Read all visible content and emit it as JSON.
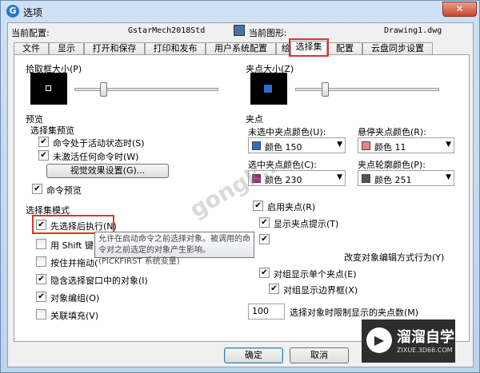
{
  "titlebar": {
    "title": "选项",
    "app_icon": "G",
    "close_glyph": "✕"
  },
  "config": {
    "current_profile_label": "当前配置:",
    "current_profile_value": "GstarMech2018Std",
    "current_drawing_label": "当前图形:",
    "current_drawing_value": "Drawing1.dwg"
  },
  "tabs": [
    "文件",
    "显示",
    "打开和保存",
    "打印和发布",
    "用户系统配置",
    "绘图",
    "选择集",
    "配置",
    "云盘同步设置"
  ],
  "active_tab": "选择集",
  "left": {
    "pickbox_size_label": "拾取框大小(P)",
    "preview_group": "预览",
    "sel_preview_label": "选择集预览",
    "cb_active_cmd": "命令处于活动状态时(S)",
    "cb_no_cmd": "未激活任何命令时(W)",
    "visual_effects_btn": "视觉效果设置(G)...",
    "cb_cmd_preview": "命令预览",
    "sel_modes_group": "选择集模式",
    "cb_noun_verb": "先选择后执行(N)",
    "cb_shift_add": "用 Shift 键",
    "cb_press_drag": "按住并拖动(",
    "cb_implied_window": "隐含选择窗口中的对象(I)",
    "cb_object_group": "对象编组(O)",
    "cb_assoc_hatch": "关联填充(V)"
  },
  "tooltip": "允许在启动命令之前选择对象。被调用的命令对之前选定的对象产生影响。(PICKFIRST 系统变量)",
  "right": {
    "grip_size_label": "夹点大小(Z)",
    "grips_group": "夹点",
    "unselected_color_label": "未选中夹点颜色(U):",
    "unselected_color_value": "颜色 150",
    "unselected_color": "#2a6fcf",
    "hover_color_label": "悬停夹点颜色(R):",
    "hover_color_value": "颜色 11",
    "hover_color": "#f08080",
    "selected_color_label": "选中夹点颜色(C):",
    "selected_color_value": "颜色 230",
    "selected_color": "#b0207e",
    "contour_color_label": "夹点轮廓颜色(P):",
    "contour_color_value": "颜色 251",
    "contour_color": "#555555",
    "cb_enable_grips": "启用夹点(R)",
    "cb_grip_tips": "显示夹点提示(T)",
    "cb_dynamic_grip_menu": "改变对象编辑方式行为(Y)",
    "cb_single_grip_group": "对组显示单个夹点(E)",
    "cb_group_bbox": "对组显示边界框(X)",
    "grip_limit_value": "100",
    "grip_limit_label": "选择对象时限制显示的夹点数(M)"
  },
  "footer": {
    "ok": "确定",
    "cancel": "取消"
  },
  "watermark": "gongk...",
  "logo": {
    "name": "溜溜自学",
    "sub": "ZIXUE.3D66.COM",
    "icon": "▶"
  },
  "check": "✔"
}
